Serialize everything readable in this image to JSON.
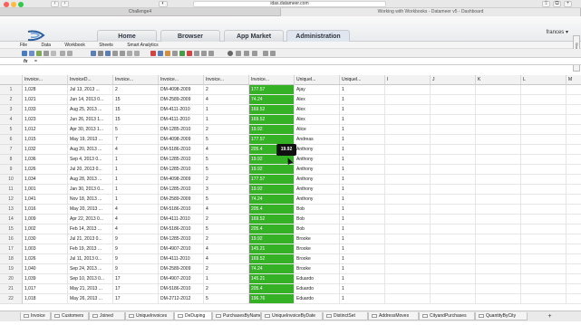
{
  "browser": {
    "url": "idas.datameer.com",
    "tabs": [
      "Challenge4",
      "Working with Workbooks - Datameer v5 - Dashboard"
    ],
    "active_tab": 1
  },
  "appbar": {
    "nav": [
      "Home",
      "Browser",
      "App Market",
      "Administration"
    ],
    "active_nav": 3,
    "user": "frances",
    "side_tab": "Show Tutorial"
  },
  "menubar": [
    "File",
    "Data",
    "Workbook",
    "Sheets",
    "Smart Analytics"
  ],
  "formula": {
    "icon": "fx",
    "value": "="
  },
  "grid": {
    "columns": [
      "Invoice...",
      "InvoiceD...",
      "Invoice...",
      "Invoice...",
      "Invoice...",
      "Invoice...",
      "UniqueI...",
      "UniqueI...",
      "I",
      "J",
      "K",
      "L",
      "M"
    ],
    "rows": [
      [
        "1,028",
        "Jul 13, 2013 ...",
        "2",
        "DM-4098-2009",
        "2",
        "177.57",
        "Ajay",
        "1"
      ],
      [
        "1,021",
        "Jun 14, 2013 0...",
        "15",
        "DM-2589-2009",
        "4",
        "74.24",
        "Alex",
        "1"
      ],
      [
        "1,033",
        "Aug 25, 2013 ...",
        "15",
        "DM-4111-2010",
        "1",
        "169.52",
        "Alex",
        "1"
      ],
      [
        "1,023",
        "Jun 26, 2013 1...",
        "15",
        "DM-4111-2010",
        "1",
        "169.52",
        "Alex",
        "1"
      ],
      [
        "1,012",
        "Apr 30, 2013 1...",
        "5",
        "DM-1285-2010",
        "2",
        "19.92",
        "Alice",
        "1"
      ],
      [
        "1,015",
        "May 19, 2013 ...",
        "7",
        "DM-4098-2009",
        "5",
        "177.57",
        "Andreas",
        "1"
      ],
      [
        "1,032",
        "Aug 20, 2013 ...",
        "4",
        "DM-5186-2010",
        "4",
        "205.4",
        "Anthony",
        "1"
      ],
      [
        "1,036",
        "Sep 4, 2013 0...",
        "1",
        "DM-1285-2010",
        "5",
        "19.92",
        "Anthony",
        "1"
      ],
      [
        "1,026",
        "Jul 20, 2013 0...",
        "1",
        "DM-1285-2010",
        "5",
        "19.92",
        "Anthony",
        "1"
      ],
      [
        "1,034",
        "Aug 28, 2013 ...",
        "1",
        "DM-4098-2009",
        "2",
        "177.57",
        "Anthony",
        "1"
      ],
      [
        "1,001",
        "Jan 30, 2013 0...",
        "1",
        "DM-1285-2010",
        "3",
        "19.92",
        "Anthony",
        "1"
      ],
      [
        "1,041",
        "Nov 18, 2013 ...",
        "1",
        "DM-2589-2009",
        "5",
        "74.24",
        "Anthony",
        "1"
      ],
      [
        "1,016",
        "May 20, 2013 ...",
        "4",
        "DM-5186-2010",
        "4",
        "205.4",
        "Bob",
        "1"
      ],
      [
        "1,009",
        "Apr 22, 2013 0...",
        "4",
        "DM-4111-2010",
        "2",
        "169.52",
        "Bob",
        "1"
      ],
      [
        "1,002",
        "Feb 14, 2013 ...",
        "4",
        "DM-5186-2010",
        "5",
        "205.4",
        "Bob",
        "1"
      ],
      [
        "1,030",
        "Jul 21, 2013 0...",
        "9",
        "DM-1285-2010",
        "2",
        "19.92",
        "Brooke",
        "1"
      ],
      [
        "1,003",
        "Feb 19, 2013 ...",
        "9",
        "DM-4907-2010",
        "4",
        "145.21",
        "Brooke",
        "1"
      ],
      [
        "1,026",
        "Jul 11, 2013 0...",
        "9",
        "DM-4111-2010",
        "4",
        "169.52",
        "Brooke",
        "1"
      ],
      [
        "1,040",
        "Sep 24, 2013 ...",
        "9",
        "DM-2589-2009",
        "2",
        "74.24",
        "Brooke",
        "1"
      ],
      [
        "1,039",
        "Sep 10, 2013 0...",
        "17",
        "DM-4907-2010",
        "1",
        "145.21",
        "Eduardo",
        "1"
      ],
      [
        "1,017",
        "May 21, 2013 ...",
        "17",
        "DM-5186-2010",
        "2",
        "205.4",
        "Eduardo",
        "1"
      ],
      [
        "1,018",
        "May 26, 2013 ...",
        "17",
        "DM-2712-2012",
        "5",
        "196.76",
        "Eduardo",
        "1"
      ]
    ],
    "tooltip": "19.92",
    "highlight_color": "#35b126"
  },
  "sheets": [
    "Invoice",
    "Customers",
    "Joined",
    "UniqueInvoices",
    "DeDuping",
    "PurchasesByName",
    "UniqueInvoiceByDate",
    "DistinctSet",
    "AddressMoves",
    "CityandPurchases",
    "QuantityByCity"
  ],
  "active_sheet": 4
}
